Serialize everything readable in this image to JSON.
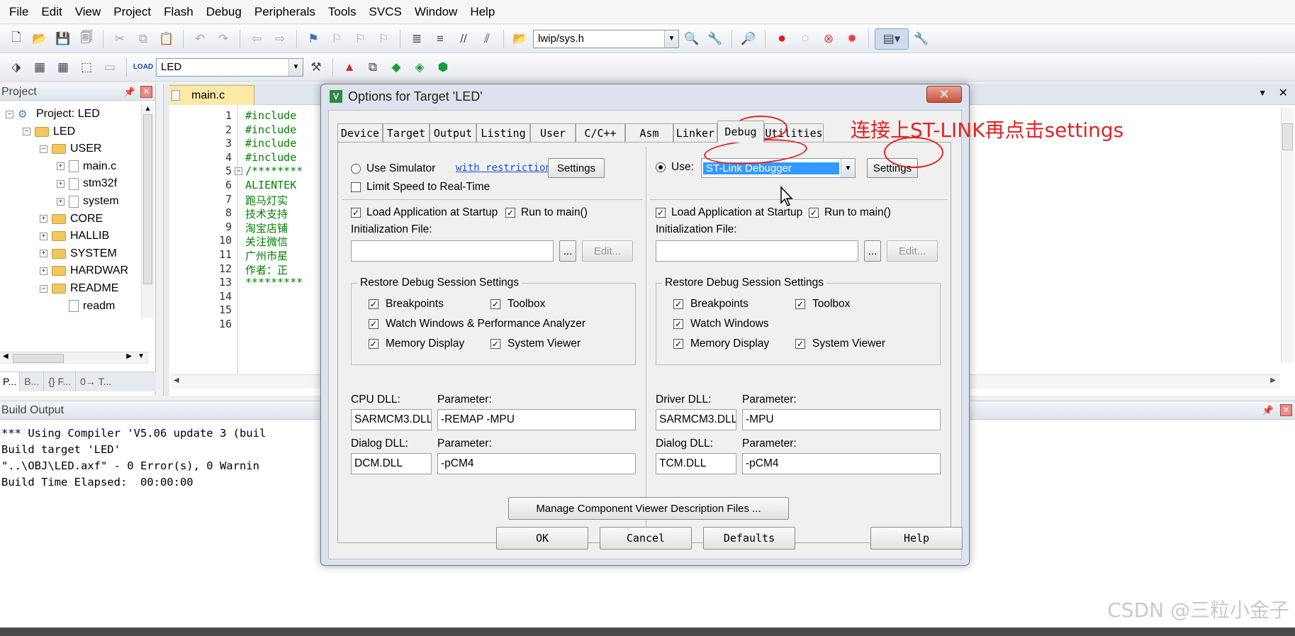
{
  "menu": [
    "File",
    "Edit",
    "View",
    "Project",
    "Flash",
    "Debug",
    "Peripherals",
    "Tools",
    "SVCS",
    "Window",
    "Help"
  ],
  "toolbar": {
    "file_combo": "lwip/sys.h",
    "target_combo": "LED"
  },
  "project_panel": {
    "title": "Project",
    "tree": [
      {
        "label": "Project: LED",
        "level": 0,
        "kind": "project",
        "expander": "−"
      },
      {
        "label": "LED",
        "level": 1,
        "kind": "folder",
        "expander": "−"
      },
      {
        "label": "USER",
        "level": 2,
        "kind": "folder",
        "expander": "−"
      },
      {
        "label": "main.c",
        "level": 3,
        "kind": "file",
        "expander": "+"
      },
      {
        "label": "stm32f",
        "level": 3,
        "kind": "file",
        "expander": "+"
      },
      {
        "label": "system",
        "level": 3,
        "kind": "file",
        "expander": "+"
      },
      {
        "label": "CORE",
        "level": 2,
        "kind": "folder",
        "expander": "+"
      },
      {
        "label": "HALLIB",
        "level": 2,
        "kind": "folder",
        "expander": "+"
      },
      {
        "label": "SYSTEM",
        "level": 2,
        "kind": "folder",
        "expander": "+"
      },
      {
        "label": "HARDWAR",
        "level": 2,
        "kind": "folder",
        "expander": "+"
      },
      {
        "label": "README",
        "level": 2,
        "kind": "folder",
        "expander": "−"
      },
      {
        "label": "readm",
        "level": 3,
        "kind": "file",
        "expander": ""
      }
    ],
    "bottom_tabs": [
      "P...",
      "B...",
      "{} F...",
      "0→ T..."
    ]
  },
  "editor": {
    "tab": "main.c",
    "lines": [
      {
        "no": "1",
        "code": "#include",
        "color": "#008000"
      },
      {
        "no": "2",
        "code": "#include",
        "color": "#008000"
      },
      {
        "no": "3",
        "code": "#include",
        "color": "#008000"
      },
      {
        "no": "4",
        "code": "#include",
        "color": "#008000"
      },
      {
        "no": "5",
        "code": "/********",
        "color": "#008000"
      },
      {
        "no": "6",
        "code": " ALIENTEK",
        "color": "#008000"
      },
      {
        "no": "7",
        "code": " 跑马灯实",
        "color": "#008000"
      },
      {
        "no": "8",
        "code": " 技术支持",
        "color": "#008000"
      },
      {
        "no": "9",
        "code": " 淘宝店铺",
        "color": "#008000"
      },
      {
        "no": "10",
        "code": " 关注微信",
        "color": "#008000"
      },
      {
        "no": "11",
        "code": " 广州市星",
        "color": "#008000"
      },
      {
        "no": "12",
        "code": " 作者：正",
        "color": "#008000"
      },
      {
        "no": "13",
        "code": "*********",
        "color": "#008000"
      },
      {
        "no": "14",
        "code": "",
        "color": "#000000"
      },
      {
        "no": "15",
        "code": "",
        "color": "#000000"
      },
      {
        "no": "16",
        "code": "",
        "color": "#000000"
      }
    ]
  },
  "build_output": {
    "title": "Build Output",
    "lines": [
      "*** Using Compiler 'V5.06 update 3 (buil",
      "Build target 'LED'",
      "\"..\\OBJ\\LED.axf\" - 0 Error(s), 0 Warnin",
      "Build Time Elapsed:  00:00:00"
    ]
  },
  "dialog": {
    "title": "Options for Target 'LED'",
    "tabs": [
      "Device",
      "Target",
      "Output",
      "Listing",
      "User",
      "C/C++",
      "Asm",
      "Linker",
      "Debug",
      "Utilities"
    ],
    "active_tab": "Debug",
    "annotation": "连接上ST-LINK再点击settings",
    "left": {
      "use_simulator": "Use Simulator",
      "restrictions_link": "with restrictions",
      "settings": "Settings",
      "limit_speed": "Limit Speed to Real-Time",
      "load_app": "Load Application at Startup",
      "run_to_main": "Run to main()",
      "init_file_label": "Initialization File:",
      "init_file_value": "",
      "browse": "...",
      "edit": "Edit...",
      "restore_title": "Restore Debug Session Settings",
      "breakpoints": "Breakpoints",
      "toolbox": "Toolbox",
      "watch_windows": "Watch Windows & Performance Analyzer",
      "memory_display": "Memory Display",
      "system_viewer": "System Viewer",
      "dll_label": "CPU DLL:",
      "dll_value": "SARMCM3.DLL",
      "param_label": "Parameter:",
      "dll_param": "-REMAP -MPU",
      "dialog_dll_label": "Dialog DLL:",
      "dialog_dll_value": "DCM.DLL",
      "dialog_param_label": "Parameter:",
      "dialog_param": "-pCM4"
    },
    "right": {
      "use": "Use:",
      "debugger": "ST-Link Debugger",
      "settings": "Settings",
      "load_app": "Load Application at Startup",
      "run_to_main": "Run to main()",
      "init_file_label": "Initialization File:",
      "init_file_value": "",
      "browse": "...",
      "edit": "Edit...",
      "restore_title": "Restore Debug Session Settings",
      "breakpoints": "Breakpoints",
      "toolbox": "Toolbox",
      "watch_windows": "Watch Windows",
      "memory_display": "Memory Display",
      "system_viewer": "System Viewer",
      "dll_label": "Driver DLL:",
      "dll_value": "SARMCM3.DLL",
      "param_label": "Parameter:",
      "dll_param": "-MPU",
      "dialog_dll_label": "Dialog DLL:",
      "dialog_dll_value": "TCM.DLL",
      "dialog_param_label": "Parameter:",
      "dialog_param": "-pCM4"
    },
    "manage_button": "Manage Component Viewer Description Files ...",
    "buttons": {
      "ok": "OK",
      "cancel": "Cancel",
      "defaults": "Defaults",
      "help": "Help"
    }
  },
  "watermark": "CSDN @三粒小金子",
  "colors": {
    "annotation": "#e02424",
    "selection": "#3399ff",
    "code_green": "#008000",
    "link": "#1b4fd6"
  }
}
